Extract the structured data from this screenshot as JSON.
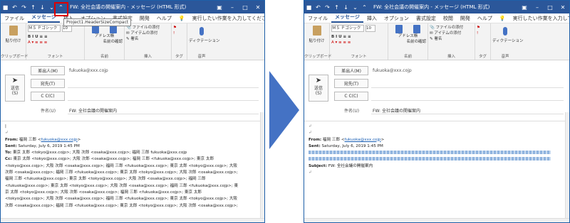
{
  "left": {
    "title": "FW: 全社会議の開催案内 - メッセージ (HTML 形式)",
    "tooltip": "Project1.HeaderSizeCompact",
    "tabs": [
      "ファイル",
      "メッセージ",
      "挿入",
      "オプション",
      "書式設定",
      "校閲",
      "開発",
      "ヘルプ"
    ],
    "tell_me": "実行したい作業を入力してください",
    "ribbon": {
      "paste": "貼り付け",
      "clipboard": "クリップボード",
      "font_name": "ＭＳ Ｐゴシック",
      "font_size": "10",
      "font_group": "フォント",
      "address_book": "アドレス帳",
      "check_names": "名前の確認",
      "names_group": "名前",
      "attach_file": "ファイルの添付",
      "attach_item": "アイテムの添付",
      "signature": "署名",
      "insert_group": "挿入",
      "tags_group": "タグ",
      "dictation": "ディクテーション",
      "voice_group": "音声"
    },
    "header": {
      "send": "送信",
      "send_key": "(S)",
      "from_btn": "差出人(M)",
      "from_val": "fukuoka@xxx.cojp",
      "to_btn": "宛先(T)",
      "cc_btn": "C C(C)",
      "subject_label": "件名(U)",
      "subject_val": "FW: 全社会議の開催案内"
    },
    "body": {
      "from_label": "From:",
      "from_name": "福岡 三郎 <",
      "from_mail": "fukuoka@xxx.cojp",
      "from_end": ">",
      "sent_label": "Sent:",
      "sent_val": "Saturday, July 6, 2019 1:45 PM",
      "to_label": "To:",
      "to_line": "東京 太郎 <tokyo@xxx.cojp>; 大阪 次郎 <osaka@xxx.cojp>; 福岡 三郎 fukuoka@xxx.cojp",
      "cc_label": "Cc:",
      "cc_line": "東京 太郎 <tokyo@xxx.cojp>; 大阪 次郎 <osaka@xxx.cojp>; 福岡 三郎 <fukuoka@xxx.cojp>; 東京 太郎",
      "lines": [
        "<tokyo@xxx.cojp>; 大阪 次郎 <osaka@xxx.cojp>; 福岡 三郎 <fukuoka@xxx.cojp>; 東京 太郎 <tokyo@xxx.cojp>; 大阪",
        "次郎 <osaka@xxx.cojp>; 福岡 三郎 <fukuoka@xxx.cojp>; 東京 太郎 <tokyo@xxx.cojp>; 大阪 次郎 <osaka@xxx.cojp>;",
        "福岡 三郎 <fukuoka@xxx.cojp>; 東京 太郎 <tokyo@xxx.cojp>; 大阪 次郎 <osaka@xxx.cojp>; 福岡 三郎",
        "<fukuoka@xxx.cojp>; 東京 太郎 <tokyo@xxx.cojp>; 大阪 次郎 <osaka@xxx.cojp>; 福岡 三郎 <fukuoka@xxx.cojp>; 東",
        "京 太郎 <tokyo@xxx.cojp>; 大阪 次郎 <osaka@xxx.cojp>; 福岡 三郎 <fukuoka@xxx.cojp>; 東京 太郎",
        "<tokyo@xxx.cojp>; 大阪 次郎 <osaka@xxx.cojp>; 福岡 三郎 <fukuoka@xxx.cojp>; 東京 太郎 <tokyo@xxx.cojp>; 大阪",
        "次郎 <osaka@xxx.cojp>; 福岡 三郎 <fukuoka@xxx.cojp>; 東京 太郎 <tokyo@xxx.cojp>; 大阪 次郎 <osaka@xxx.cojp>;"
      ]
    }
  },
  "right": {
    "title": "FW: 全社会議の開催案内 - メッセージ (HTML 形式)",
    "tabs": [
      "ファイル",
      "メッセージ",
      "挿入",
      "オプション",
      "書式設定",
      "校閲",
      "開発",
      "ヘルプ"
    ],
    "tell_me": "実行したい作業を入力してください",
    "ribbon": {
      "paste": "貼り付け",
      "clipboard": "クリップボード",
      "font_name": "ＭＳ Ｐゴシック",
      "font_size": "10",
      "font_group": "フォント",
      "address_book": "アドレス帳",
      "check_names": "名前の確認",
      "names_group": "名前",
      "attach_file": "ファイルの添付",
      "attach_item": "アイテムの添付",
      "signature": "署名",
      "insert_group": "挿入",
      "tags_group": "タグ",
      "dictation": "ディクテーション",
      "voice_group": "音声"
    },
    "header": {
      "send": "送信",
      "send_key": "(S)",
      "from_btn": "差出人(M)",
      "from_val": "fukuoka@xxx.cojp",
      "to_btn": "宛先(T)",
      "cc_btn": "C C(C)",
      "subject_label": "件名(U)",
      "subject_val": "FW: 全社会議の開催案内"
    },
    "body": {
      "from_label": "From:",
      "from_name": "福岡 三郎 <",
      "from_mail": "fukuoka@xxx.cojp",
      "from_end": ">",
      "sent_label": "Sent:",
      "sent_val": "Saturday, July 6, 2019 1:45 PM",
      "subject_label": "Subject:",
      "subject_val": "FW: 全社会議の開催案内"
    }
  }
}
